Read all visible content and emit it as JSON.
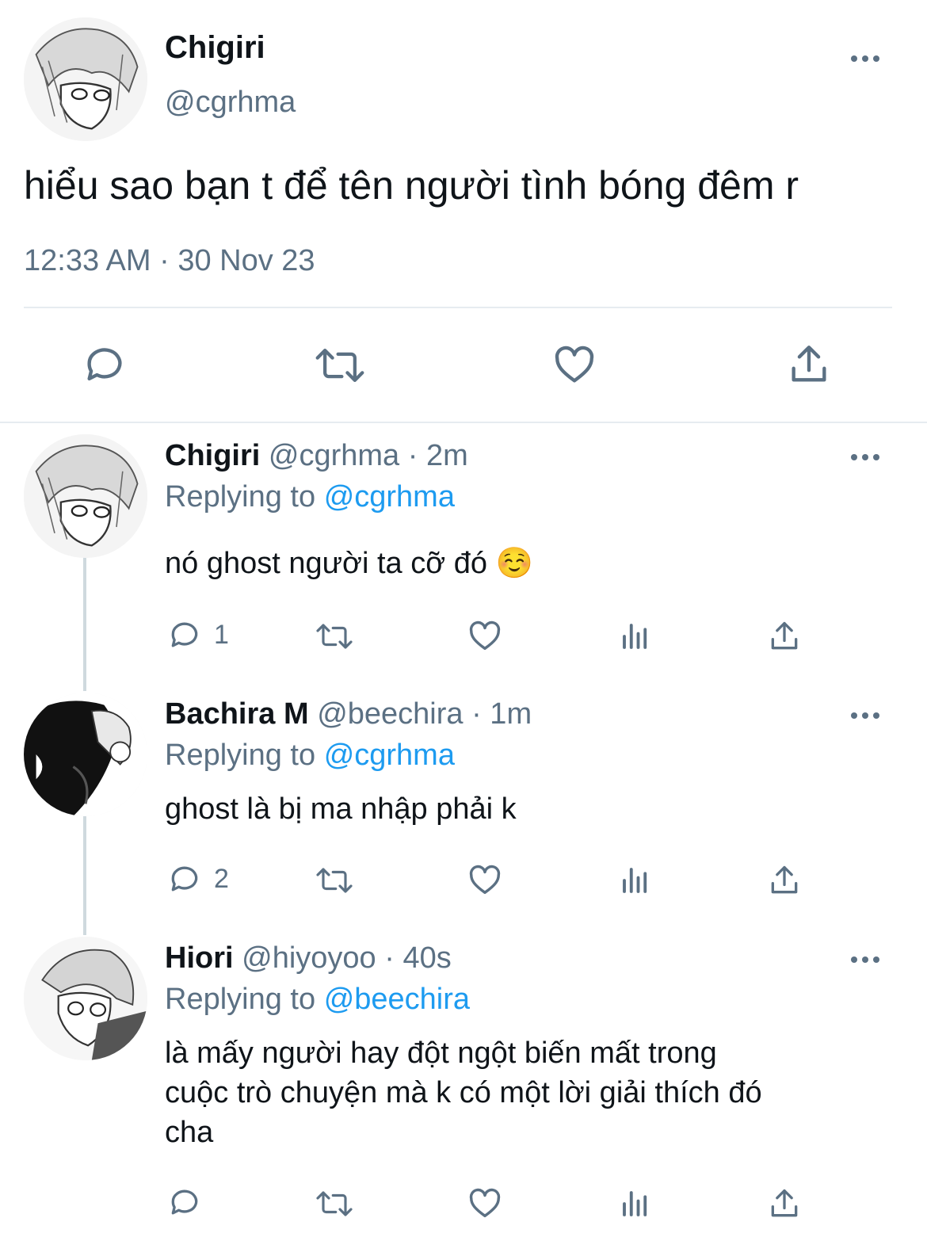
{
  "main_tweet": {
    "display_name": "Chigiri",
    "handle": "@cgrhma",
    "text": "hiểu sao bạn t để tên người tình bóng đêm r",
    "timestamp": "12:33 AM · 30 Nov 23",
    "more_icon": "more-horizontal-icon",
    "actions": [
      "reply-icon",
      "retweet-icon",
      "like-icon",
      "share-icon"
    ]
  },
  "replies": [
    {
      "display_name": "Chigiri",
      "handle": "@cgrhma",
      "meta": "· 2m",
      "replying_prefix": "Replying to",
      "replying_to": "@cgrhma",
      "text": "nó ghost người ta cỡ đó ☺️",
      "reply_count": "1"
    },
    {
      "display_name": "Bachira M",
      "handle": "@beechira",
      "meta": "· 1m",
      "replying_prefix": "Replying to",
      "replying_to": "@cgrhma",
      "text": "ghost là bị ma nhập phải k",
      "reply_count": "2"
    },
    {
      "display_name": "Hiori",
      "handle": "@hiyoyoo",
      "meta": "· 40s",
      "replying_prefix": "Replying to",
      "replying_to": "@beechira",
      "text_lines": [
        "là mấy người hay đột ngột biến mất trong",
        "cuộc trò chuyện mà k có một lời giải thích đó",
        "cha"
      ],
      "reply_count": ""
    }
  ],
  "colors": {
    "text": "#0f1419",
    "muted": "#5b7083",
    "link": "#1d9bf0",
    "divider": "#e6ecf0"
  }
}
